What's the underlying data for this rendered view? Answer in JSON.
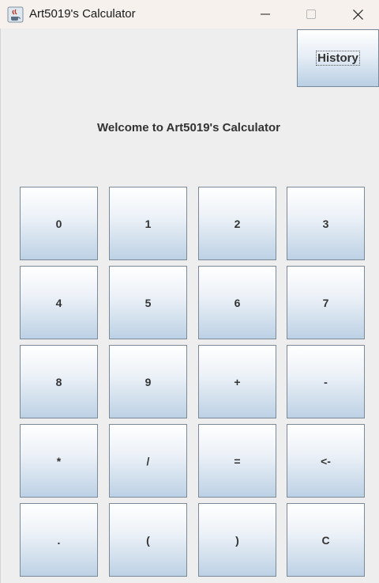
{
  "window": {
    "title": "Art5019's Calculator"
  },
  "header": {
    "history_label": "History",
    "welcome": "Welcome to Art5019's Calculator"
  },
  "keypad": {
    "keys": [
      "0",
      "1",
      "2",
      "3",
      "4",
      "5",
      "6",
      "7",
      "8",
      "9",
      "+",
      "-",
      "*",
      "/",
      "=",
      "<-",
      ".",
      "(",
      ")",
      "C"
    ]
  },
  "colors": {
    "titlebar_bg": "#f6f1ec",
    "window_bg": "#eeeeee",
    "button_border": "#7a8a99",
    "button_gradient_bottom": "#bdd1e5"
  },
  "icons": {
    "app": "java-coffee-icon",
    "minimize": "minimize-icon",
    "maximize": "maximize-icon",
    "close": "close-icon"
  }
}
